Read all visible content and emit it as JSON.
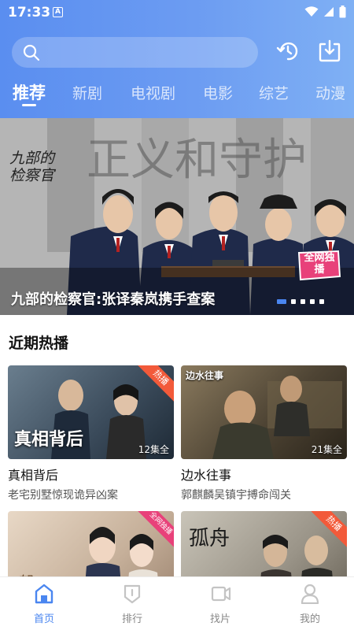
{
  "status_bar": {
    "time": "17:33",
    "notification_glyph": "A"
  },
  "header": {
    "search_placeholder": "",
    "tabs": [
      {
        "label": "推荐",
        "active": true
      },
      {
        "label": "新剧",
        "active": false
      },
      {
        "label": "电视剧",
        "active": false
      },
      {
        "label": "电影",
        "active": false
      },
      {
        "label": "综艺",
        "active": false
      },
      {
        "label": "动漫",
        "active": false
      }
    ],
    "accent_color": "#5a8ef0"
  },
  "banner": {
    "caption": "九部的检察官:张译秦岚携手查案",
    "badge": "全网独播",
    "calligraphy": "九部的检察官",
    "slide_count": 5,
    "active_slide": 1
  },
  "recent": {
    "title": "近期热播",
    "cards": [
      {
        "title": "真相背后",
        "desc": "老宅别墅惊现诡异凶案",
        "episodes": "12集全",
        "tag": "热播",
        "thumb_text": "真相背后"
      },
      {
        "title": "边水往事",
        "desc": "郭麒麟吴镇宇搏命闯关",
        "episodes": "21集全",
        "tag": "",
        "thumb_text": "边水往事"
      },
      {
        "title": "",
        "desc": "",
        "episodes": "",
        "tag": "全网独播",
        "thumb_text": ""
      },
      {
        "title": "",
        "desc": "",
        "episodes": "",
        "tag": "热播",
        "thumb_text": "孤舟"
      }
    ]
  },
  "bottom_nav": [
    {
      "label": "首页",
      "icon": "home-icon",
      "active": true
    },
    {
      "label": "排行",
      "icon": "ranking-icon",
      "active": false
    },
    {
      "label": "找片",
      "icon": "video-camera-icon",
      "active": false
    },
    {
      "label": "我的",
      "icon": "profile-icon",
      "active": false
    }
  ],
  "colors": {
    "active_nav": "#4a86f0",
    "hot_tag": "#f25a3a",
    "exclusive_badge": "#e8417a"
  }
}
